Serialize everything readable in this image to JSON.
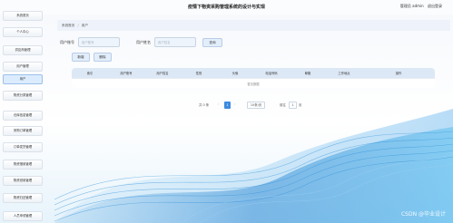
{
  "app": {
    "title": "疫情下物资采购管理系统的设计与实现"
  },
  "header": {
    "user_role": "管理员 admin",
    "logout_label": "退出登录"
  },
  "sidebar": {
    "items": [
      {
        "label": "系统首页"
      },
      {
        "label": "个人中心"
      },
      {
        "label": "供应商管理"
      },
      {
        "label": "用户管理"
      },
      {
        "label": "用户"
      },
      {
        "label": "物资分类管理"
      },
      {
        "label": "仓库信息管理"
      },
      {
        "label": "采购订单管理"
      },
      {
        "label": "订单发货管理"
      },
      {
        "label": "物资借用管理"
      },
      {
        "label": "物资领用管理"
      },
      {
        "label": "物资归还管理"
      },
      {
        "label": "人员申领管理"
      }
    ]
  },
  "breadcrumb": {
    "home": "系统首页",
    "separator": "/",
    "current": "用户"
  },
  "search": {
    "account_label": "用户账号",
    "account_placeholder": "用户账号",
    "name_label": "用户姓名",
    "name_placeholder": "用户姓名",
    "button_label": "查询"
  },
  "actions": {
    "add_label": "新增",
    "delete_label": "删除"
  },
  "table": {
    "columns": [
      "索引",
      "用户账号",
      "用户姓名",
      "性别",
      "头像",
      "电话号码",
      "邮箱",
      "工作地点",
      "操作"
    ],
    "empty_text": "暂无数据"
  },
  "pagination": {
    "total_text": "共 0 条",
    "prev_icon": "‹",
    "current_page": "1",
    "next_icon": "›",
    "page_size": "10条/页",
    "goto_label": "前往",
    "goto_value": "1",
    "page_suffix": "页"
  },
  "watermark": "CSDN @毕业设计"
}
